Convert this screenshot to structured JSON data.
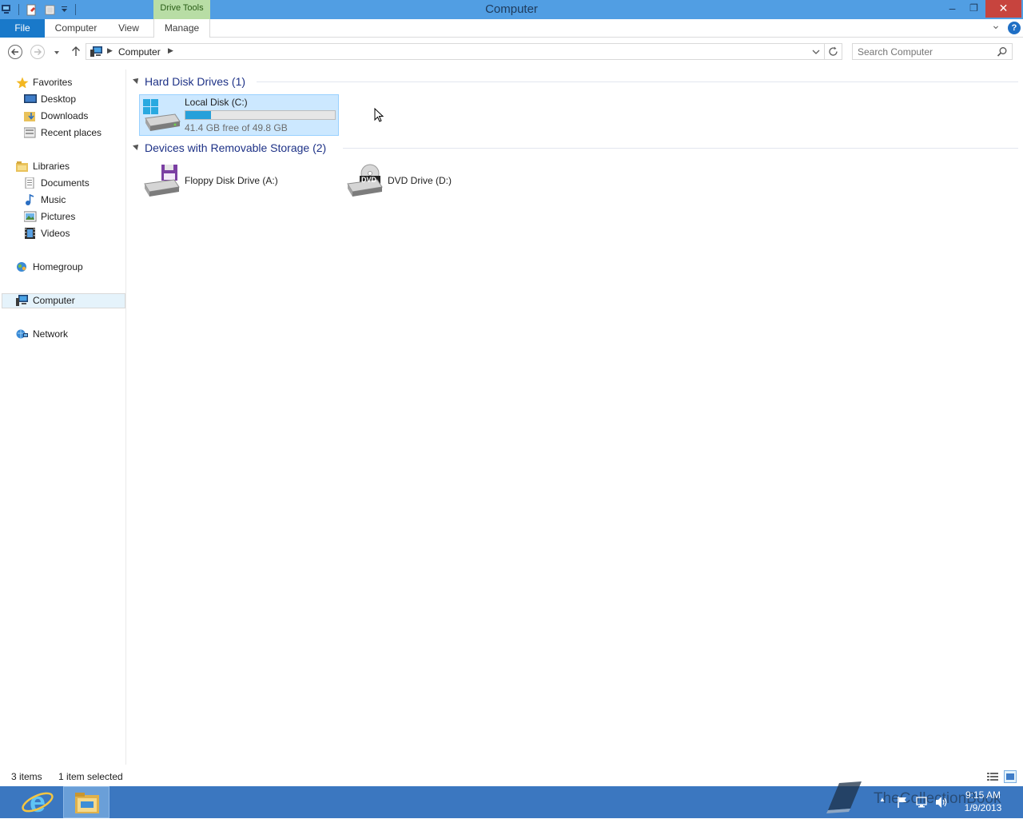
{
  "window": {
    "title": "Computer",
    "contextual_tab": "Drive Tools",
    "minimize_symbol": "–",
    "restore_symbol": "❐",
    "close_symbol": "✕"
  },
  "ribbon": {
    "tabs": [
      {
        "label": "File"
      },
      {
        "label": "Computer"
      },
      {
        "label": "View"
      },
      {
        "label": "Manage"
      }
    ],
    "expand_symbol": "⌄",
    "help_symbol": "?"
  },
  "address": {
    "path": [
      "Computer"
    ],
    "search_placeholder": "Search Computer"
  },
  "navigation": {
    "favorites": {
      "label": "Favorites",
      "items": [
        "Desktop",
        "Downloads",
        "Recent places"
      ]
    },
    "libraries": {
      "label": "Libraries",
      "items": [
        "Documents",
        "Music",
        "Pictures",
        "Videos"
      ]
    },
    "homegroup": "Homegroup",
    "computer": "Computer",
    "network": "Network"
  },
  "groups": [
    {
      "header": "Hard Disk Drives (1)",
      "items": [
        {
          "name": "Local Disk (C:)",
          "details": "41.4 GB free of 49.8 GB",
          "used_fraction": 0.169,
          "selected": true
        }
      ]
    },
    {
      "header": "Devices with Removable Storage (2)",
      "items": [
        {
          "name": "Floppy Disk Drive (A:)"
        },
        {
          "name": "DVD Drive (D:)",
          "icon_text": "DVD"
        }
      ]
    }
  ],
  "status": {
    "item_count": "3 items",
    "selection": "1 item selected"
  },
  "taskbar": {
    "time": "9:15 AM",
    "date": "1/9/2013",
    "watermark": "TheCollectionBook"
  },
  "colors": {
    "titlebar": "#519ee3",
    "file_tab": "#1979ca",
    "selection_bg": "#cce8ff",
    "drive_bar_fill": "#26a0da",
    "taskbar": "#3b77c0",
    "group_header": "#1e3287"
  }
}
